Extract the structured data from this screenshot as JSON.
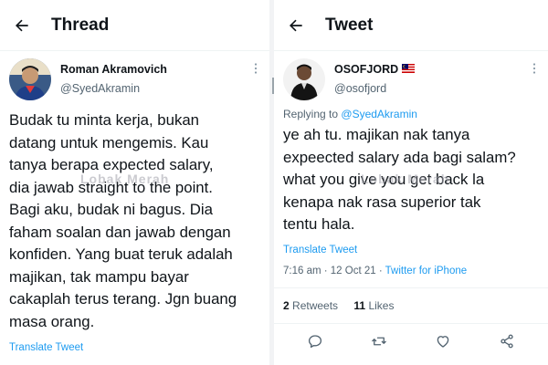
{
  "left": {
    "header_title": "Thread",
    "author_name": "Roman Akramovich",
    "author_handle": "@SyedAkramin",
    "tweet_text": "Budak tu minta kerja, bukan\ndatang untuk mengemis. Kau\ntanya berapa expected salary,\ndia jawab straight to the point.\nBagi aku, budak ni bagus. Dia\nfaham soalan dan jawab dengan\nkonfiden. Yang buat teruk adalah\nmajikan, tak mampu bayar\ncakaplah terus terang. Jgn buang\nmasa orang.",
    "translate": "Translate Tweet"
  },
  "right": {
    "header_title": "Tweet",
    "author_name": "OSOFJORD",
    "author_handle": "@osofjord",
    "replying_prefix": "Replying to",
    "replying_handle": "@SyedAkramin",
    "tweet_text": "ye ah tu. majikan nak tanya\nexpeected salary ada bagi salam?\nwhat you give you get back la\nkenapa nak rasa superior tak\ntentu hala.",
    "translate": "Translate Tweet",
    "time": "7:16 am · 12 Oct 21 · ",
    "source": "Twitter for iPhone",
    "retweets_count": "2",
    "retweets_label": "Retweets",
    "likes_count": "11",
    "likes_label": "Likes"
  },
  "watermark": "Lobak Merah",
  "icons": {
    "back": "arrow-left-icon",
    "more": "more-vertical-icon",
    "reply": "comment-icon",
    "retweet": "retweet-icon",
    "like": "heart-icon",
    "share": "share-icon",
    "flag": "malaysia-flag-icon"
  },
  "colors": {
    "accent": "#1d9bf0",
    "text": "#0f1419",
    "muted": "#536471"
  }
}
